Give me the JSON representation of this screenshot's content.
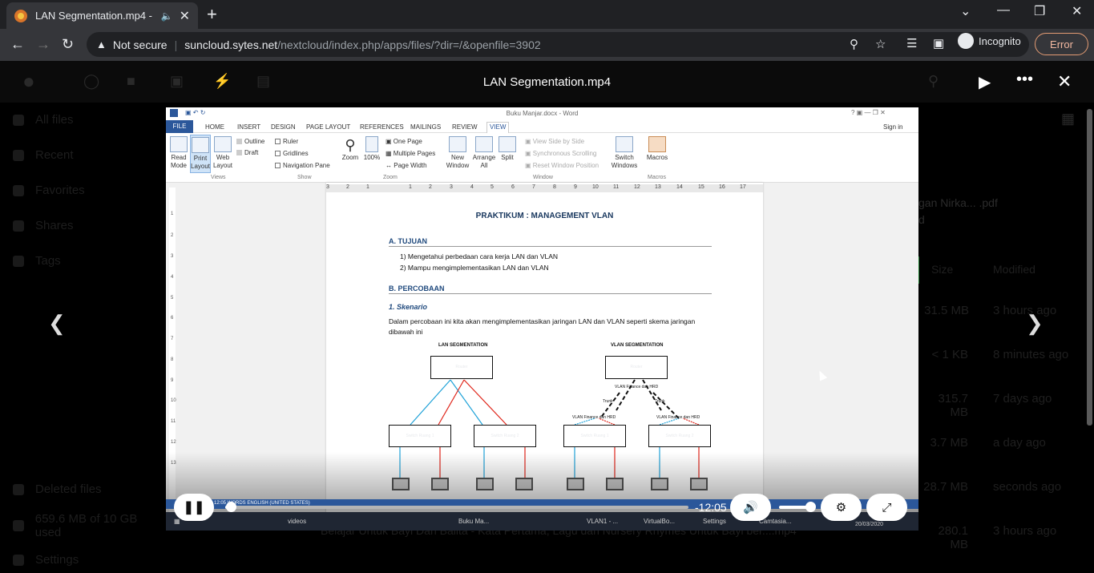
{
  "browser": {
    "tab_title": "LAN Segmentation.mp4 - Su",
    "new_tab": "+",
    "url_host": "suncloud.sytes.net",
    "url_path": "/nextcloud/index.php/apps/files/?dir=/&openfile=3902",
    "security_label": "Not secure",
    "profile_label": "Incognito",
    "error_label": "Error"
  },
  "viewer": {
    "title": "LAN Segmentation.mp4"
  },
  "sidebar": {
    "items": [
      {
        "label": "All files",
        "icon": "folder-icon"
      },
      {
        "label": "Recent",
        "icon": "clock-icon"
      },
      {
        "label": "Favorites",
        "icon": "star-icon"
      },
      {
        "label": "Shares",
        "icon": "share-icon"
      },
      {
        "label": "Tags",
        "icon": "tag-icon"
      }
    ],
    "deleted": "Deleted files",
    "quota": "659.6 MB of 10 GB used",
    "settings": "Settings"
  },
  "files": {
    "partial_name": "gan Nirka... .pdf",
    "partial_name2": "d",
    "col_size": "Size",
    "col_modified": "Modified",
    "rows": [
      {
        "size": "31.5 MB",
        "modified": "3 hours ago"
      },
      {
        "size": "< 1 KB",
        "modified": "8 minutes ago"
      },
      {
        "size": "315.7 MB",
        "modified": "7 days ago"
      },
      {
        "size": "3.7 MB",
        "modified": "a day ago"
      },
      {
        "size": "28.7 MB",
        "modified": "seconds ago"
      },
      {
        "size": "280.1 MB",
        "modified": "3 hours ago"
      }
    ],
    "bottom_filename": "Belajar Untuk Bayi Dan Balita - Kata Pertama, Lagu dan Nursery Rhymes Untuk Bayi ber....mp4"
  },
  "word": {
    "window_title": "Buku Manjar.docx - Word",
    "signin": "Sign in",
    "tabs": [
      "FILE",
      "HOME",
      "INSERT",
      "DESIGN",
      "PAGE LAYOUT",
      "REFERENCES",
      "MAILINGS",
      "REVIEW",
      "VIEW"
    ],
    "views": {
      "read": "Read Mode",
      "print": "Print Layout",
      "web": "Web Layout",
      "group": "Views"
    },
    "outline": "Outline",
    "draft": "Draft",
    "show": {
      "ruler": "Ruler",
      "gridlines": "Gridlines",
      "navpane": "Navigation Pane",
      "group": "Show"
    },
    "zoom": {
      "zoom": "Zoom",
      "pct": "100%",
      "one": "One Page",
      "multi": "Multiple Pages",
      "width": "Page Width",
      "group": "Zoom"
    },
    "window": {
      "new": "New Window",
      "arrange": "Arrange All",
      "split": "Split",
      "side": "View Side by Side",
      "sync": "Synchronous Scrolling",
      "reset": "Reset Window Position",
      "switch": "Switch Windows",
      "group": "Window"
    },
    "macros": {
      "label": "Macros",
      "group": "Macros"
    },
    "status": "12:05 WORDS    ENGLISH (UNITED STATES)"
  },
  "doc": {
    "title": "PRAKTIKUM : MANAGEMENT VLAN",
    "h1": "A.  TUJUAN",
    "item1": "1)   Mengetahui perbedaan cara kerja LAN dan VLAN",
    "item2": "2)   Mampu mengimplementasikan LAN dan VLAN",
    "h2": "B.  PERCOBAAN",
    "sub": "1.  Skenario",
    "para1": "Dalam percobaan ini kita akan mengimplementasikan jaringan LAN dan VLAN seperti skema jaringan",
    "para2": "dibawah ini",
    "lan_title": "LAN SEGMENTATION",
    "vlan_title": "VLAN SEGMENTATION",
    "router": "Router",
    "switch1": "Switch Ruang 1",
    "switch2": "Switch Ruang 2",
    "vlan_fin": "VLAN Finance dan HRD",
    "trunk": "Trunk"
  },
  "taskbar": {
    "items": [
      "videos",
      "Buku Ma...",
      "Settings",
      "VLAN1 - ...",
      "VirtualBo...",
      "Camtasia..."
    ],
    "date": "20/03/2020"
  },
  "player": {
    "time": "-12:05",
    "progress": 0.012,
    "volume": 0.8
  }
}
